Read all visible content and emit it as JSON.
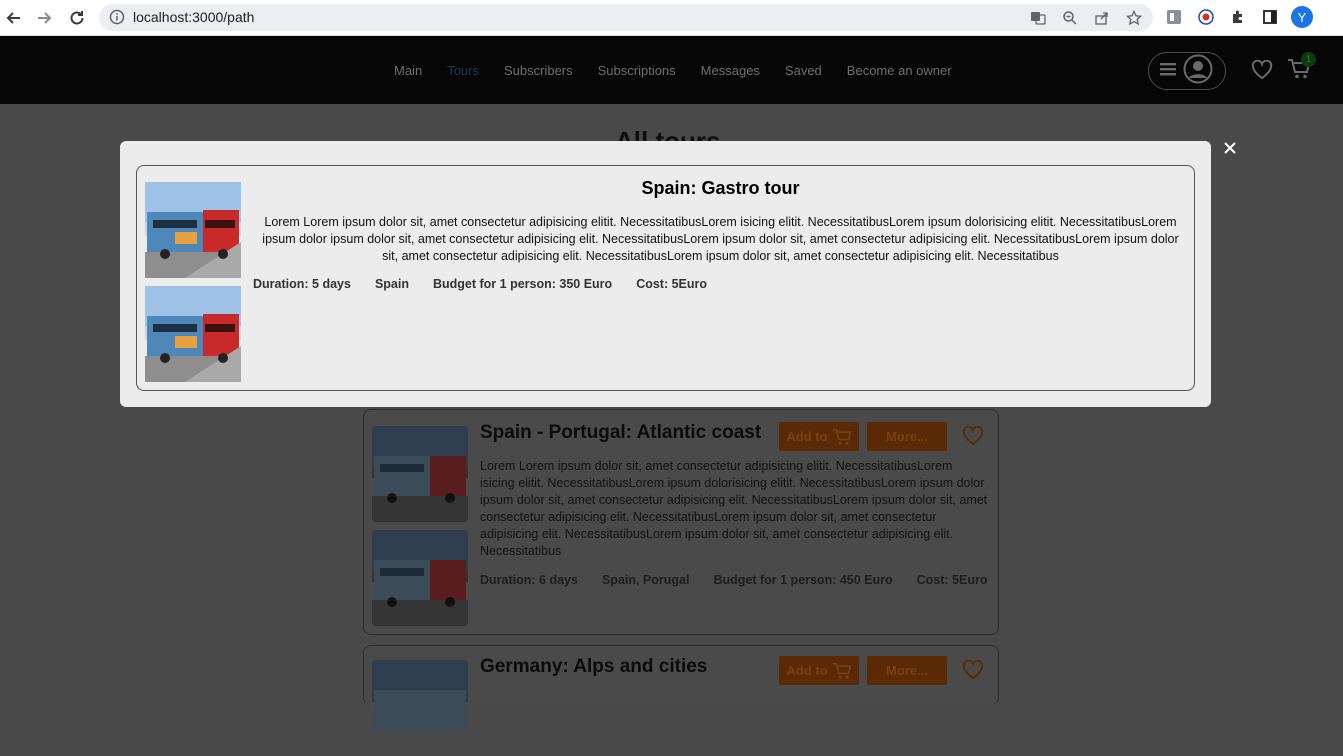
{
  "browser": {
    "url": "localhost:3000/path",
    "profile_initial": "Y"
  },
  "site": {
    "nav": [
      "Main",
      "Tours",
      "Subscribers",
      "Subscriptions",
      "Messages",
      "Saved",
      "Become an owner"
    ],
    "active_nav": "Tours",
    "cart_count": "1"
  },
  "page": {
    "title": "All tours"
  },
  "modal": {
    "title": "Spain: Gastro tour",
    "description": "Lorem Lorem ipsum dolor sit, amet consectetur adipisicing elitit. NecessitatibusLorem isicing elitit. NecessitatibusLorem ipsum dolorisicing elitit. NecessitatibusLorem ipsum dolor ipsum dolor sit, amet consectetur adipisicing elit. NecessitatibusLorem ipsum dolor sit, amet consectetur adipisicing elit. NecessitatibusLorem ipsum dolor sit, amet consectetur adipisicing elit. NecessitatibusLorem ipsum dolor sit, amet consectetur adipisicing elit. Necessitatibus",
    "duration": "Duration: 5 days",
    "country": "Spain",
    "budget": "Budget for 1 person: 350 Euro",
    "cost": "Cost: 5Euro"
  },
  "tours": [
    {
      "title": "Spain - Portugal: Atlantic coast",
      "description": "Lorem Lorem ipsum dolor sit, amet consectetur adipisicing elitit. NecessitatibusLorem isicing elitit. NecessitatibusLorem ipsum dolorisicing elitit. NecessitatibusLorem ipsum dolor ipsum dolor sit, amet consectetur adipisicing elit. NecessitatibusLorem ipsum dolor sit, amet consectetur adipisicing elit. NecessitatibusLorem ipsum dolor sit, amet consectetur adipisicing elit. NecessitatibusLorem ipsum dolor sit, amet consectetur adipisicing elit. Necessitatibus",
      "duration": "Duration: 6 days",
      "country": "Spain, Porugal",
      "budget": "Budget for 1 person: 450 Euro",
      "cost": "Cost: 5Euro",
      "add_label": "Add to",
      "more_label": "More..."
    },
    {
      "title": "Germany: Alps and cities",
      "add_label": "Add to",
      "more_label": "More..."
    }
  ],
  "colors": {
    "accent_button": "#5a2a06",
    "header_bg": "#060607",
    "overlay_bg": "#494949"
  }
}
